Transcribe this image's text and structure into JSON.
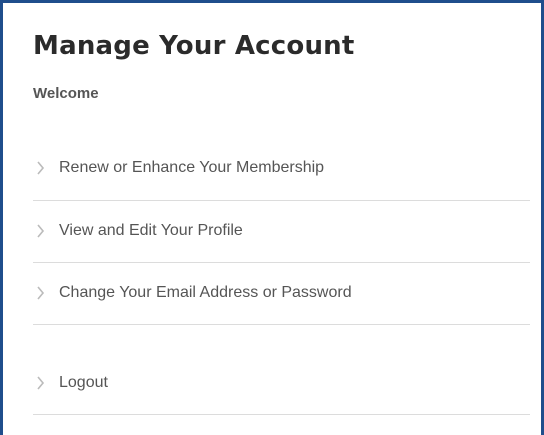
{
  "account_panel": {
    "title": "Manage Your Account",
    "welcome": "Welcome",
    "menu_items": [
      {
        "label": "Renew or Enhance Your Membership",
        "icon": "chevron-right-icon"
      },
      {
        "label": "View and Edit Your Profile",
        "icon": "chevron-right-icon"
      },
      {
        "label": "Change Your Email Address or Password",
        "icon": "chevron-right-icon"
      },
      {
        "label": "Logout",
        "icon": "chevron-right-icon"
      }
    ]
  },
  "colors": {
    "frame_border": "#1f4e8c",
    "title_text": "#2b2b2b",
    "menu_text": "#555555",
    "chevron": "#bbbbbb",
    "divider": "#dcdcdc"
  }
}
